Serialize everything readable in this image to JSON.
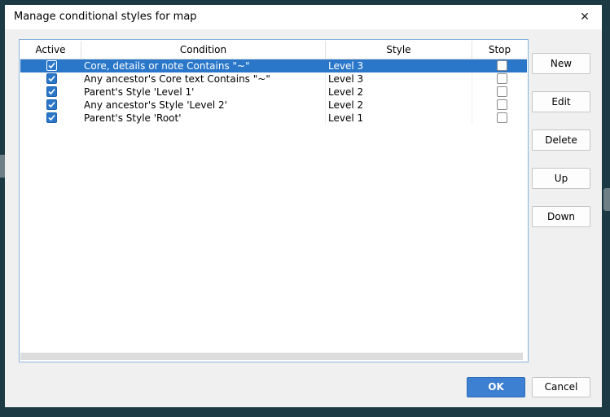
{
  "dialog": {
    "title": "Manage conditional styles for map",
    "close_icon": "close-icon"
  },
  "table": {
    "headers": {
      "active": "Active",
      "condition": "Condition",
      "style": "Style",
      "stop": "Stop"
    },
    "rows": [
      {
        "active": true,
        "condition": "Core, details or note Contains \"~\"",
        "style": "Level 3",
        "stop": false,
        "selected": true
      },
      {
        "active": true,
        "condition": "Any ancestor's Core text Contains \"~\"",
        "style": "Level 3",
        "stop": false,
        "selected": false
      },
      {
        "active": true,
        "condition": "Parent's Style 'Level 1'",
        "style": "Level 2",
        "stop": false,
        "selected": false
      },
      {
        "active": true,
        "condition": "Any ancestor's Style 'Level 2'",
        "style": "Level 2",
        "stop": false,
        "selected": false
      },
      {
        "active": true,
        "condition": "Parent's Style 'Root'",
        "style": "Level 1",
        "stop": false,
        "selected": false
      }
    ]
  },
  "buttons": {
    "new": "New",
    "edit": "Edit",
    "delete": "Delete",
    "up": "Up",
    "down": "Down",
    "ok": "OK",
    "cancel": "Cancel"
  },
  "colors": {
    "accent": "#2a77c9",
    "ok_button": "#3d7fd0",
    "desktop_background": "#1c3a44"
  }
}
